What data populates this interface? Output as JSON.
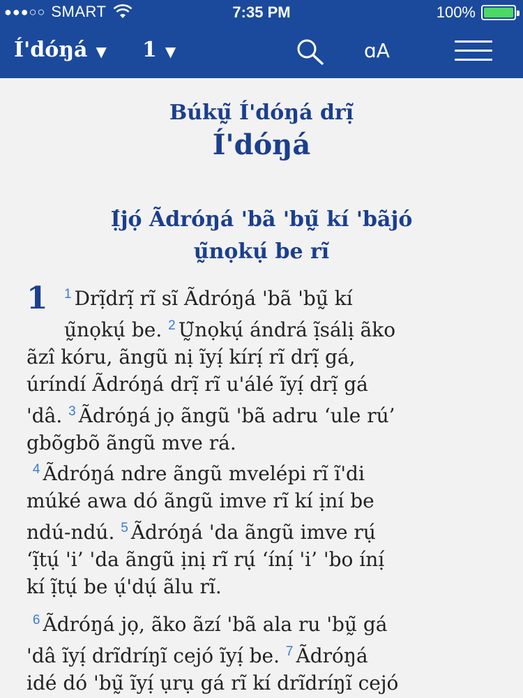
{
  "status": {
    "signal_dots": "●●●○○",
    "carrier": "SMART",
    "time": "7:35 PM",
    "battery": "100%",
    "battery_level": 1.0
  },
  "nav": {
    "book": "Í'dóŋá",
    "chapter": "1",
    "font_label": "ɑA"
  },
  "book_title": "Búkṵ̃ Í'dóŋá drị̃",
  "book_heading": "Í'dóŋá",
  "section_heading_1": "Ị́jọ́ Ãdróŋá 'bã 'bṵ̃ kí 'bãjó",
  "section_heading_2": "ṵ̃nọkụ́ be rĩ",
  "chapter_number": "1",
  "verses": {
    "v1": "1",
    "v1_a": "Drị̃drị̃ rĩ sĩ Ãdróŋá 'bã 'bṵ̃ kí",
    "v1_b": "ṵ̃nọkụ́ be.",
    "v2": "2",
    "v2_a": "Ṵ̃nọkụ́ ándrá ị̃sálị ãko",
    "v2_b": "ãzî kóru, ãngũ nị ĩyị́ kírị́ rĩ drị̃ gá,",
    "v2_c": "úríndí Ãdróŋá drị̃ rĩ u'álé ĩyị́ drị̃ gá",
    "v2_d": "'dâ.",
    "v3": "3",
    "v3_a": "Ãdróŋá jọ ãngũ 'bã adru ‘ule rú’",
    "v3_b": "gbõgbõ ãngũ mve rá.",
    "v4": "4",
    "v4_a": "Ãdróŋá ndre ãngũ mvelépi rĩ ĩ'di",
    "v4_b": "múké awa dó ãngũ imve rĩ kí ịní be",
    "v4_c": "ndú-ndú.",
    "v5": "5",
    "v5_a": "Ãdróŋá 'da ãngũ imve rụ́",
    "v5_b": "‘ị̃tụ́ 'i’ 'da ãngũ ịnị rĩ rụ́ ‘ínị́ 'i’ 'bo ínị́",
    "v5_c": "kí ị̃tụ́ be ụ́'dụ́ ãlu rĩ.",
    "v6": "6",
    "v6_a": "Ãdróŋá jọ, ãko ãzí 'bã ala ru 'bṵ̃ gá",
    "v6_b": "'dâ ĩyị́ drĩdríŋĩ cejó ĩyị́ be.",
    "v7": "7",
    "v7_a": "Ãdróŋá",
    "v7_b": "idé dó 'bṵ̃ ĩyị́ ụrụ gá rĩ kí drĩdríŋĩ cejó"
  }
}
